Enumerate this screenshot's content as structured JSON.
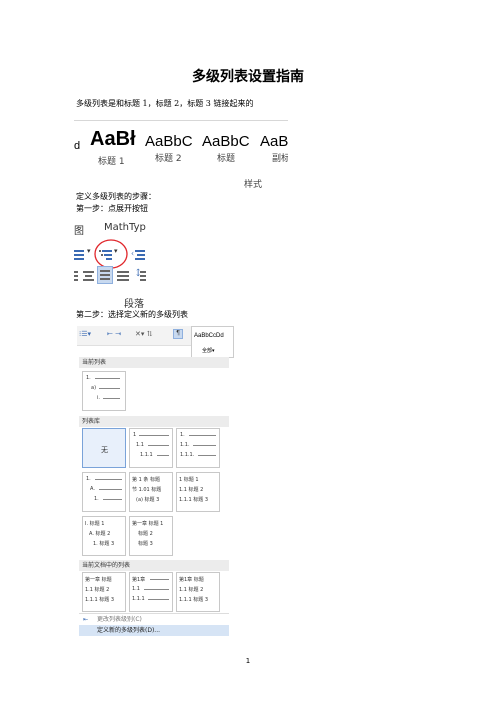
{
  "doc": {
    "title": "多级列表设置指南",
    "intro": "多级列表是和标题 1，标题 2，标题 3 链接起来的",
    "steps_heading": "定义多级列表的步骤：",
    "step1": "第一步：点展开按钮",
    "step2": "第二步：选择定义新的多级列表",
    "page_number": "1"
  },
  "styles_gallery": {
    "leading_char": "d",
    "items": [
      {
        "sample": "AaBł",
        "name": "标题 1"
      },
      {
        "sample": "AaBbC",
        "name": "标题 2"
      },
      {
        "sample": "AaBbC",
        "name": "标题"
      },
      {
        "sample": "AaBl",
        "name": "副标"
      }
    ],
    "caption": "样式"
  },
  "ribbon_crop": {
    "tab_fragment": "图",
    "tab_mathtype": "MathTyp",
    "group_caption": "段落"
  },
  "multilevel_menu": {
    "preview_sample": "AaBbCcDd",
    "filter_label": "全部",
    "current_list_header": "当前列表",
    "list_library_header": "列表库",
    "none_label": "无",
    "in_document_header": "当前文档中的列表",
    "change_level_item": "更改列表级别(C)",
    "define_new_item": "定义新的多级列表(D)...",
    "thumb_texts": {
      "a1": "1.",
      "a2": "a)",
      "a3": "i.",
      "b1": "1",
      "b2": "1.1",
      "b3": "1.1.1",
      "c1": "1.",
      "c2": "1.1.",
      "c3": "1.1.1.",
      "d1": "1.",
      "d2": "A.",
      "d3": "1.",
      "e1": "第 1 条 标题",
      "e2": "节 1.01 标题",
      "e3": "(a) 标题 3",
      "f1": "1 标题 1",
      "f2": "1.1 标题 2",
      "f3": "1.1.1 标题 3",
      "g1": "I. 标题 1",
      "g2": "A. 标题 2",
      "g3": "1. 标题 3",
      "h1": "第一章 标题 1",
      "h2": "标题 2",
      "h3": "标题 3",
      "i1": "第一章 标题",
      "i2": "1.1 标题 2",
      "i3": "1.1.1 标题 3",
      "j1": "第1章",
      "j2": "1.1",
      "j3": "1.1.1",
      "k1": "第1章 标题",
      "k2": "1.1 标题 2",
      "k3": "1.1.1 标题 3"
    }
  }
}
